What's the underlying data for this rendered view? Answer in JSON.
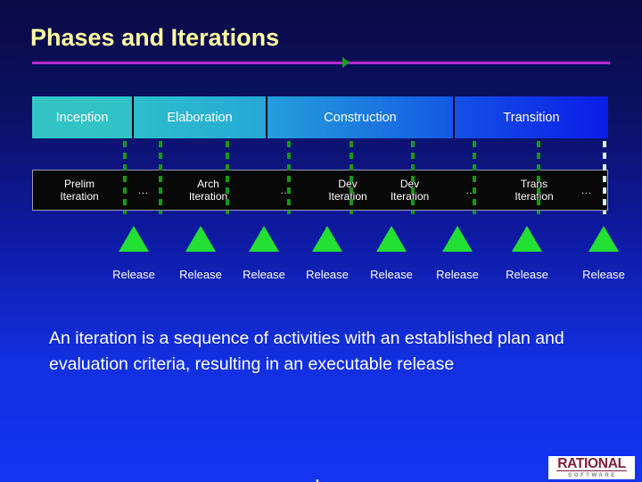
{
  "slide": {
    "title": "Phases and Iterations",
    "background_top": "#0a0a46",
    "background_bottom": "#1434f2",
    "title_color": "#ffffa0",
    "rule_color": "#b22ccc",
    "marker_color": "#0aa81e"
  },
  "phases": [
    {
      "label": "Inception"
    },
    {
      "label": "Elaboration"
    },
    {
      "label": "Construction"
    },
    {
      "label": "Transition"
    }
  ],
  "iterations": [
    {
      "line1": "Prelim",
      "line2": "Iteration"
    },
    {
      "line1": "…",
      "line2": ""
    },
    {
      "line1": "Arch",
      "line2": "Iteration"
    },
    {
      "line1": "…",
      "line2": ""
    },
    {
      "line1": "Dev",
      "line2": "Iteration"
    },
    {
      "line1": "Dev",
      "line2": "Iteration"
    },
    {
      "line1": "…",
      "line2": ""
    },
    {
      "line1": "Trans",
      "line2": "Iteration"
    },
    {
      "line1": "…",
      "line2": ""
    }
  ],
  "releases": [
    {
      "label": "Release"
    },
    {
      "label": "Release"
    },
    {
      "label": "Release"
    },
    {
      "label": "Release"
    },
    {
      "label": "Release"
    },
    {
      "label": "Release"
    },
    {
      "label": "Release"
    },
    {
      "label": "Release"
    }
  ],
  "release_color": "#22e034",
  "body": {
    "text": "An iteration is a sequence of activities with an established plan and evaluation criteria, resulting in an executable release"
  },
  "logo": {
    "word": "RATIONAL",
    "subtitle": "SOFTWARE",
    "word_color": "#7b2038",
    "subtitle_color": "#7b7b8c"
  },
  "page_mark": "•"
}
